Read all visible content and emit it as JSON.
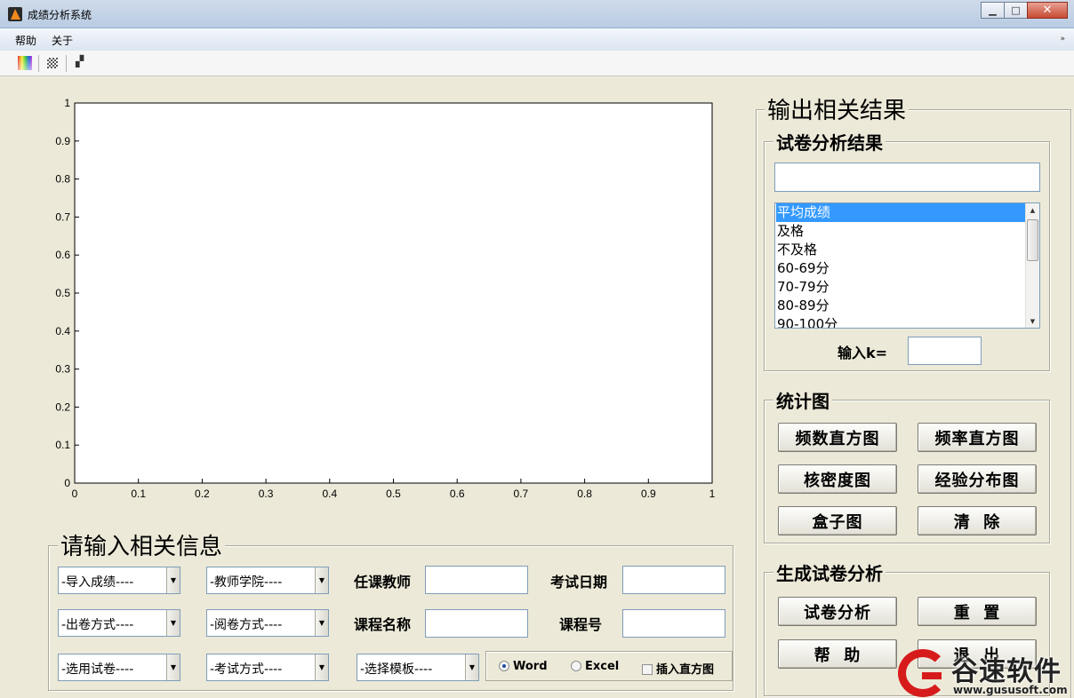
{
  "window": {
    "title": "成绩分析系统",
    "minimize": "▁",
    "maximize": "□",
    "close": "✕"
  },
  "menu": {
    "items": [
      "帮助",
      "关于"
    ],
    "overflow": "»"
  },
  "toolbar": {
    "colormap_icon": "colormap-icon",
    "grid_icon": "grid-icon",
    "histogram_icon": "histogram-icon"
  },
  "chart_data": {
    "type": "line",
    "series": [],
    "xlim": [
      0,
      1
    ],
    "ylim": [
      0,
      1
    ],
    "xticks": [
      "0",
      "0.1",
      "0.2",
      "0.3",
      "0.4",
      "0.5",
      "0.6",
      "0.7",
      "0.8",
      "0.9",
      "1"
    ],
    "yticks": [
      "0",
      "0.1",
      "0.2",
      "0.3",
      "0.4",
      "0.5",
      "0.6",
      "0.7",
      "0.8",
      "0.9",
      "1"
    ],
    "grid": false
  },
  "input_panel": {
    "title": "请输入相关信息",
    "popups": {
      "import_scores": "-导入成绩----",
      "teacher_college": "-教师学院----",
      "exam_paper_type": "-出卷方式----",
      "marking_type": "-阅卷方式----",
      "select_paper": "-选用试卷----",
      "exam_type": "-考试方式----",
      "select_template": "-选择模板----"
    },
    "labels": {
      "teacher": "任课教师",
      "exam_date": "考试日期",
      "course_name": "课程名称",
      "course_no": "课程号"
    },
    "values": {
      "teacher": "",
      "exam_date": "",
      "course_name": "",
      "course_no": ""
    },
    "output_options": {
      "word": "Word",
      "excel": "Excel",
      "insert_hist": "插入直方图",
      "selected": "Word"
    }
  },
  "output_panel": {
    "title": "输出相关结果",
    "analysis": {
      "title": "试卷分析结果",
      "result_text": "",
      "list_items": [
        "平均成绩",
        "及格",
        "不及格",
        "60-69分",
        "70-79分",
        "80-89分",
        "90-100分"
      ],
      "selected_index": 0,
      "k_label": "输入k=",
      "k_value": ""
    },
    "charts": {
      "title": "统计图",
      "freq_hist": "频数直方图",
      "rate_hist": "频率直方图",
      "kde": "核密度图",
      "ecdf": "经验分布图",
      "boxplot": "盒子图",
      "clear": "清  除"
    },
    "report": {
      "title": "生成试卷分析",
      "analyze": "试卷分析",
      "reset": "重  置",
      "help": "帮  助",
      "exit": "退  出"
    }
  },
  "watermark": {
    "name": "谷速软件",
    "url": "www.gususoft.com",
    "accent": "#d71b1b"
  }
}
